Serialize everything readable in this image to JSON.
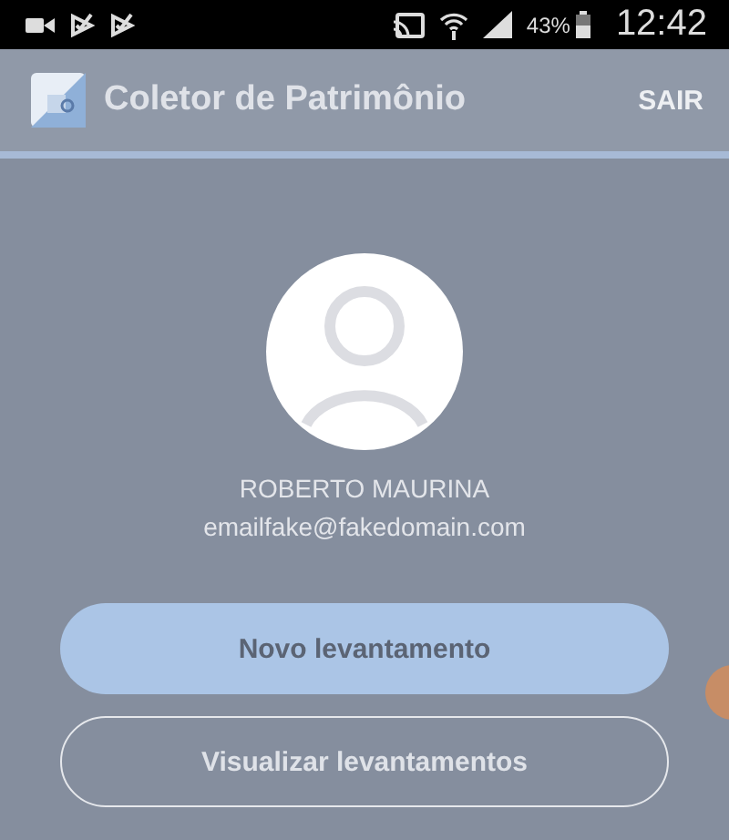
{
  "status_bar": {
    "battery": "43%",
    "time": "12:42"
  },
  "app_bar": {
    "title": "Coletor de Patrimônio",
    "action": "SAIR"
  },
  "profile": {
    "name": "ROBERTO MAURINA",
    "email": "emailfake@fakedomain.com"
  },
  "buttons": [
    {
      "label": "Novo levantamento",
      "kind": "filled"
    },
    {
      "label": "Visualizar levantamentos",
      "kind": "outlined"
    }
  ]
}
